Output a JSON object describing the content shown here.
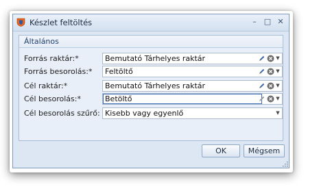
{
  "window": {
    "title": "Készlet feltöltés",
    "minimize_glyph": "–",
    "maximize_glyph": "□",
    "close_glyph": "✕"
  },
  "group": {
    "title": "Általános"
  },
  "fields": [
    {
      "label": "Forrás raktár:*",
      "value": "Bemutató Tárhelyes raktár",
      "has_edit": true,
      "has_clear": true,
      "has_dropdown": true
    },
    {
      "label": "Forrás besorolás:*",
      "value": "Feltöltő",
      "has_edit": true,
      "has_clear": true,
      "has_dropdown": true
    },
    {
      "label": "Cél raktár:*",
      "value": "Bemutató Tárhelyes raktár",
      "has_edit": true,
      "has_clear": true,
      "has_dropdown": true
    },
    {
      "label": "Cél besorolás:*",
      "value": "Betöltő",
      "has_edit": true,
      "has_clear": true,
      "has_dropdown": true,
      "focused": true
    },
    {
      "label": "Cél besorolás szűrő:",
      "value": "Kisebb vagy egyenlő",
      "has_edit": false,
      "has_clear": false,
      "has_dropdown": true
    }
  ],
  "buttons": {
    "ok": "OK",
    "cancel": "Mégsem"
  },
  "colors": {
    "accent": "#3e6db3",
    "window_bg": "#dde7f3",
    "group_bg": "#e9eff8"
  }
}
